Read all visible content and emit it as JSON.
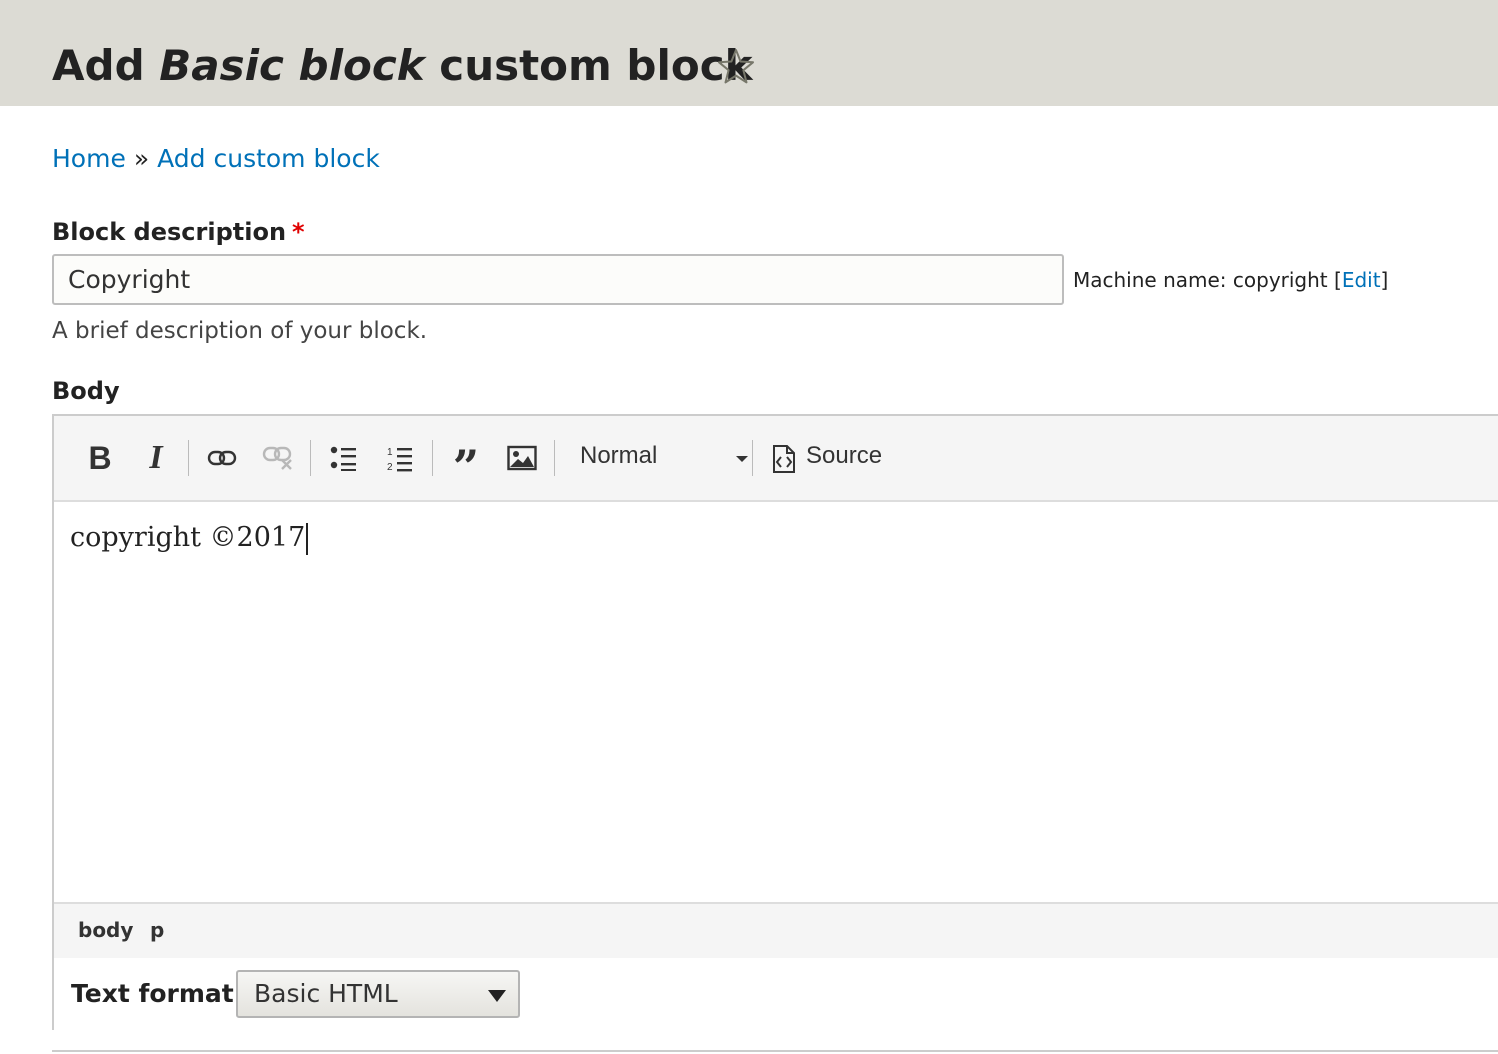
{
  "header": {
    "title_prefix": "Add ",
    "title_em": "Basic block",
    "title_suffix": " custom block",
    "shortcut_icon": "star-outline-icon"
  },
  "breadcrumb": {
    "items": [
      "Home",
      "Add custom block"
    ],
    "separator": "»"
  },
  "block_description": {
    "label": "Block description",
    "required_mark": "*",
    "value": "Copyright",
    "machine_name_prefix": "Machine name: copyright [",
    "machine_name_edit": "Edit",
    "machine_name_suffix": "]",
    "help_text": "A brief description of your block."
  },
  "body": {
    "label": "Body",
    "toolbar": {
      "buttons": [
        "bold-icon",
        "italic-icon",
        "link-icon",
        "unlink-icon",
        "bulleted-list-icon",
        "numbered-list-icon",
        "blockquote-icon",
        "image-icon"
      ],
      "format_value": "Normal",
      "source_label": "Source"
    },
    "content": "copyright ©2017",
    "element_path": [
      "body",
      "p"
    ]
  },
  "text_format": {
    "label": "Text format",
    "selected": "Basic HTML"
  },
  "colors": {
    "header_bg": "#dcdbd4",
    "link": "#0071b8",
    "required": "#e00000"
  }
}
